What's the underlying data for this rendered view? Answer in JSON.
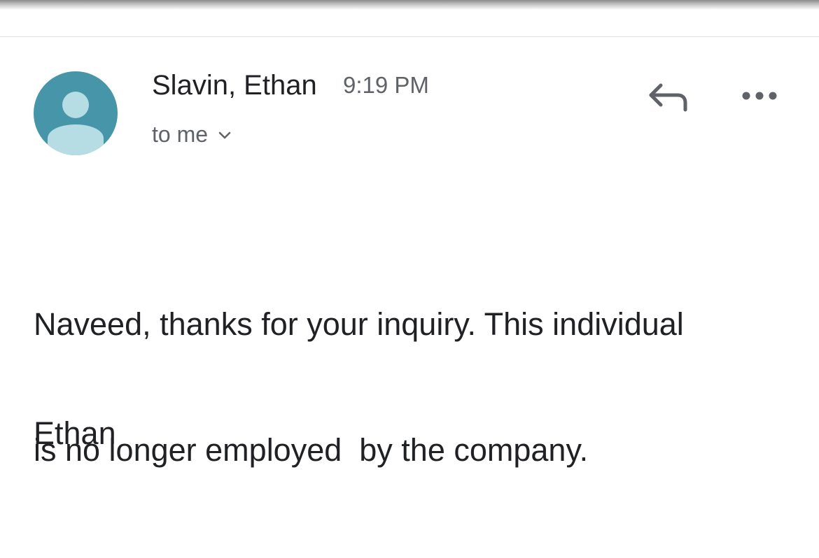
{
  "email": {
    "sender_name": "Slavin, Ethan",
    "time": "9:19 PM",
    "recipient": "to me",
    "body_line1": "Naveed, thanks for your inquiry. This individual",
    "body_line2": "is no longer employed  by the company.",
    "signature": "Ethan"
  },
  "icons": {
    "avatar": "person-icon",
    "recipient_toggle": "chevron-down-icon",
    "reply": "reply-icon",
    "more": "more-horizontal-icon"
  },
  "colors": {
    "avatar_background": "#4795a8",
    "avatar_figure": "#b5dde3",
    "primary_text": "#202124",
    "secondary_text": "#5f6368"
  }
}
